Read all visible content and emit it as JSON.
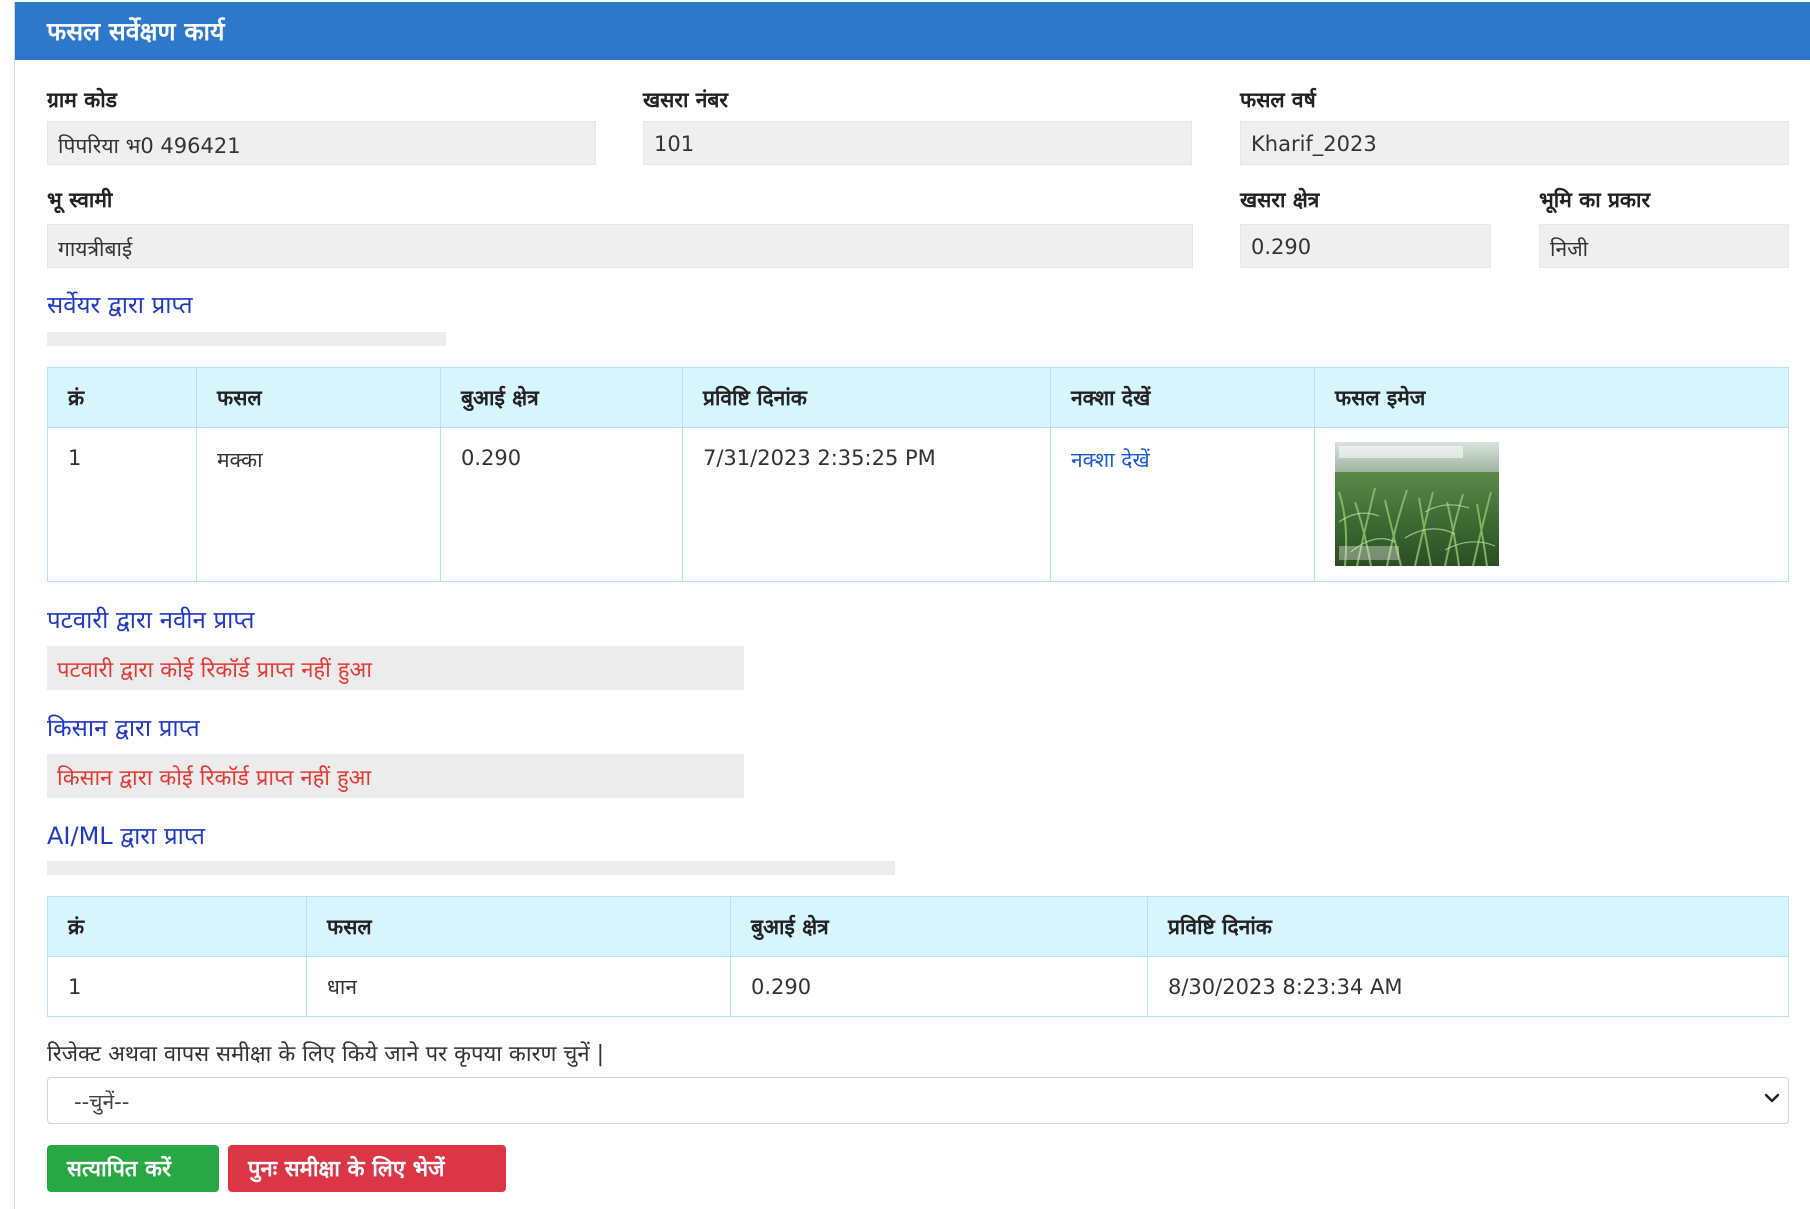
{
  "header": {
    "title": "फसल सर्वेक्षण कार्य"
  },
  "fields": {
    "gram_code_label": "ग्राम कोड",
    "gram_code_value": "पिपरिया भ0 496421",
    "khasra_label": "खसरा नंबर",
    "khasra_value": "101",
    "crop_year_label": "फसल वर्ष",
    "crop_year_value": "Kharif_2023",
    "owner_label": "भू स्वामी",
    "owner_value": "गायत्रीबाई",
    "area_label": "खसरा क्षेत्र",
    "area_value": "0.290",
    "land_type_label": "भूमि का प्रकार",
    "land_type_value": "निजी"
  },
  "surveyor": {
    "title": "सर्वेयर द्वारा प्राप्त",
    "headers": [
      "क्रं",
      "फसल",
      "बुआई क्षेत्र",
      "प्रविष्टि दिनांक",
      "नक्शा देखें",
      "फसल इमेज"
    ],
    "row": {
      "sn": "1",
      "crop": "मक्का",
      "area": "0.290",
      "date": "7/31/2023 2:35:25 PM",
      "map_link": "नक्शा देखें"
    }
  },
  "patwari": {
    "title": "पटवारी द्वारा नवीन प्राप्त",
    "message": "पटवारी द्वारा कोई रिकॉर्ड प्राप्त नहीं हुआ"
  },
  "farmer": {
    "title": "किसान द्वारा प्राप्त",
    "message": "किसान द्वारा कोई रिकॉर्ड प्राप्त नहीं हुआ"
  },
  "aiml": {
    "title": "AI/ML द्वारा प्राप्त",
    "headers": [
      "क्रं",
      "फसल",
      "बुआई क्षेत्र",
      "प्रविष्टि दिनांक"
    ],
    "row": {
      "sn": "1",
      "crop": "धान",
      "area": "0.290",
      "date": "8/30/2023 8:23:34 AM"
    }
  },
  "reason": {
    "note": "रिजेक्ट अथवा वापस समीक्षा के लिए किये जाने पर कृपया कारण चुनें |",
    "selected": "--चुनें--"
  },
  "buttons": {
    "verify": "सत्यापित करें",
    "review": "पुनः समीक्षा के लिए भेजें"
  }
}
